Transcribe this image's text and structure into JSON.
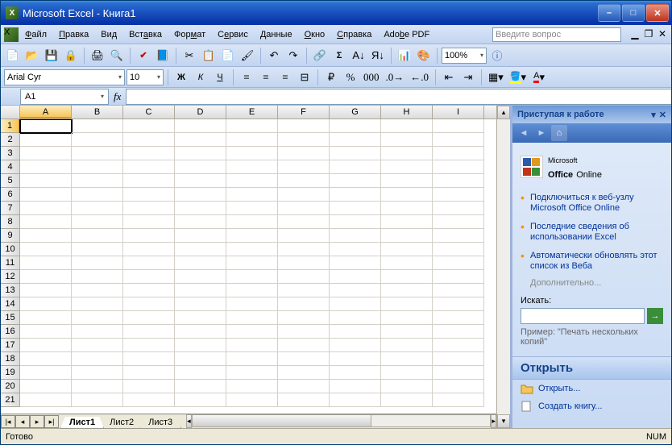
{
  "title": "Microsoft Excel - Книга1",
  "menu": [
    "Файл",
    "Правка",
    "Вид",
    "Вставка",
    "Формат",
    "Сервис",
    "Данные",
    "Окно",
    "Справка",
    "Adobe PDF"
  ],
  "help_placeholder": "Введите вопрос",
  "zoom": "100%",
  "font_name": "Arial Cyr",
  "font_size": "10",
  "cell_ref": "A1",
  "columns": [
    "A",
    "B",
    "C",
    "D",
    "E",
    "F",
    "G",
    "H",
    "I"
  ],
  "active_col": "A",
  "rows": [
    1,
    2,
    3,
    4,
    5,
    6,
    7,
    8,
    9,
    10,
    11,
    12,
    13,
    14,
    15,
    16,
    17,
    18,
    19,
    20,
    21
  ],
  "active_row": 1,
  "sheet_tabs": [
    "Лист1",
    "Лист2",
    "Лист3"
  ],
  "active_tab": "Лист1",
  "taskpane": {
    "title": "Приступая к работе",
    "office_online_prefix": "Microsoft",
    "office_online_brand": "Office",
    "office_online_suffix": "Online",
    "links": [
      "Подключиться к веб-узлу Microsoft Office Online",
      "Последние сведения об использовании Excel",
      "Автоматически обновлять этот список из Веба"
    ],
    "more": "Дополнительно...",
    "search_label": "Искать:",
    "example_label": "Пример:",
    "example_text": "\"Печать нескольких копий\"",
    "open_header": "Открыть",
    "open_link": "Открыть...",
    "create_link": "Создать книгу..."
  },
  "status": {
    "left": "Готово",
    "right": "NUM"
  }
}
